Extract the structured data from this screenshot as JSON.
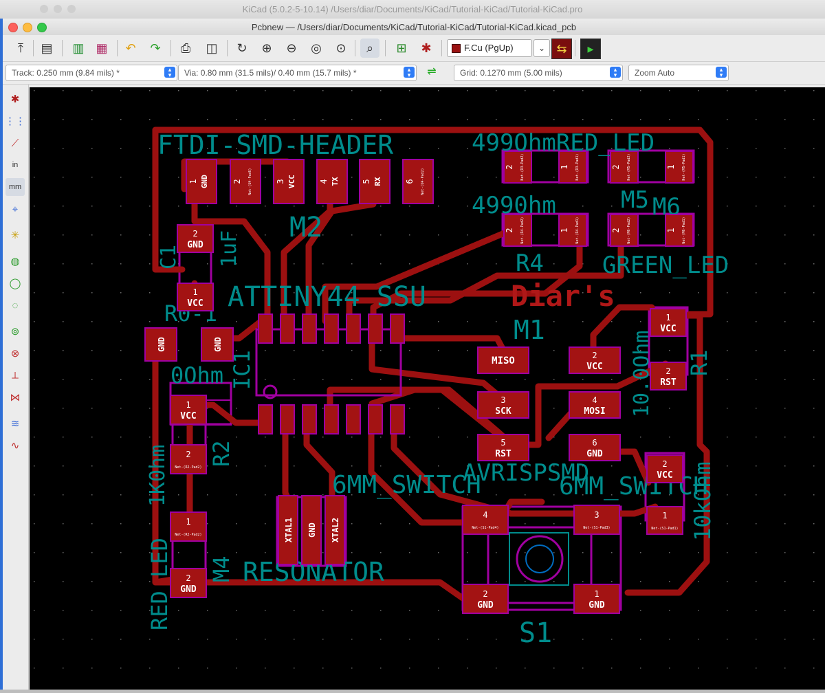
{
  "outer_window": {
    "title": "KiCad (5.0.2-5-10.14) /Users/diar/Documents/KiCad/Tutorial-KiCad/Tutorial-KiCad.pro"
  },
  "window": {
    "title": "Pcbnew — /Users/diar/Documents/KiCad/Tutorial-KiCad/Tutorial-KiCad.kicad_pcb"
  },
  "toolbar": {
    "layer": "F.Cu (PgUp)",
    "icons": [
      "new-board-icon",
      "page-settings-icon",
      "load-board-icon",
      "library-browser-icon",
      "footprint-editor-icon",
      "undo-icon",
      "redo-icon",
      "print-icon",
      "plot-icon",
      "redraw-icon",
      "zoom-in-icon",
      "zoom-out-icon",
      "zoom-fit-icon",
      "zoom-selection-icon",
      "find-icon",
      "netlist-icon",
      "drc-icon",
      "layer-pair-icon",
      "scripting-icon"
    ]
  },
  "aux_toolbar": {
    "track": "Track: 0.250 mm (9.84 mils) *",
    "via": "Via: 0.80 mm (31.5 mils)/ 0.40 mm (15.7 mils) *",
    "grid": "Grid: 0.1270 mm (5.00 mils)",
    "zoom": "Zoom Auto"
  },
  "colors": {
    "track": "#9c1010",
    "pad": "#a31313",
    "courtyard": "#a000a0",
    "silk": "#008c8c",
    "pad_text": "#ffffff",
    "background": "#000000",
    "accent": "#2f7cf6"
  },
  "board": {
    "silkscreen": {
      "ftdi": "FTDI-SMD-HEADER",
      "led_top": "499OhmRED_LED",
      "r3": "4990hm",
      "m5": "M5",
      "m6": "M6",
      "m2": "M2",
      "r4": "R4",
      "green_led": "GREEN_LED",
      "diar": "Diar's",
      "attiny": "ATTINY44 SSU",
      "m1": "M1",
      "c1": "C1",
      "uf": "1uF",
      "r0": "R0-1",
      "ohm0": "0Ohm",
      "ic1": "IC1",
      "r1": "R1",
      "r10k": "10.0Ohm",
      "r2": "R2",
      "r2val": "1K0hm",
      "sw1": "6MM_SWITCH",
      "sw2": "6MM_SWITCH",
      "avrisp": "AVRISPSMD",
      "r10k2": "10kOhm",
      "red_led": "RED_LED",
      "m4": "M4",
      "resonator": "RESONATOR",
      "s1": "S1"
    },
    "pads": {
      "ftdi1": {
        "num": "1",
        "net": "GND"
      },
      "ftdi2": {
        "num": "2",
        "net": "Net-(U4-Pad6)"
      },
      "ftdi3": {
        "num": "3",
        "net": "VCC"
      },
      "ftdi4": {
        "num": "4",
        "net": "TX"
      },
      "ftdi5": {
        "num": "5",
        "net": "RX"
      },
      "ftdi6": {
        "num": "6",
        "net": "Net-(U4-Pad2)"
      },
      "c1_2": {
        "num": "2",
        "net": "GND"
      },
      "c1_1": {
        "num": "1",
        "net": "VCC"
      },
      "r0_gnd1": {
        "net": "GND"
      },
      "r0_gnd2": {
        "net": "GND"
      },
      "r2_1": {
        "num": "1",
        "net": "VCC"
      },
      "r2_2": {
        "num": "2",
        "net": "Net-(R2-Pad2)"
      },
      "m4_1": {
        "num": "1",
        "net": "Net-(R2-Pad2)"
      },
      "m4_2": {
        "num": "2",
        "net": "GND"
      },
      "miso": {
        "net": "MISO"
      },
      "isp2": {
        "num": "2",
        "net": "VCC"
      },
      "sck": {
        "num": "3",
        "net": "SCK"
      },
      "mosi": {
        "num": "4",
        "net": "MOSI"
      },
      "rst5": {
        "num": "5",
        "net": "RST"
      },
      "gnd6": {
        "num": "6",
        "net": "GND"
      },
      "r1_1": {
        "num": "1",
        "net": "VCC"
      },
      "r1_2": {
        "num": "2",
        "net": "RST"
      },
      "r_sw_2": {
        "num": "2",
        "net": "VCC"
      },
      "r_sw_1": {
        "num": "1",
        "net": "Net-(S1-Pad1)"
      },
      "s1_4": {
        "num": "4",
        "net": "Net-(S1-Pad4)"
      },
      "s1_3": {
        "num": "3",
        "net": "Net-(S1-Pad3)"
      },
      "s1_2": {
        "num": "2",
        "net": "GND"
      },
      "s1_1": {
        "num": "1",
        "net": "GND"
      },
      "res_1": {
        "net": "XTAL1"
      },
      "res_g": {
        "net": "GND"
      },
      "res_2": {
        "net": "XTAL2"
      },
      "r3_2": {
        "num": "2",
        "net": "Net-(R3-Pad2)"
      },
      "r3_1": {
        "num": "1",
        "net": "Net-(R3-Pad1)"
      },
      "m5_2": {
        "num": "2",
        "net": "Net-(M5-Pad2)"
      },
      "m5_1": {
        "num": "1",
        "net": "Net-(M5-Pad1)"
      },
      "r4_2": {
        "num": "2",
        "net": "Net-(R4-Pad2)"
      },
      "r4_1": {
        "num": "1",
        "net": "Net-(R4-Pad1)"
      },
      "m6_2": {
        "num": "2",
        "net": "Net-(M6-Pad2)"
      },
      "m6_1": {
        "num": "1",
        "net": "Net-(M6-Pad1)"
      }
    }
  }
}
